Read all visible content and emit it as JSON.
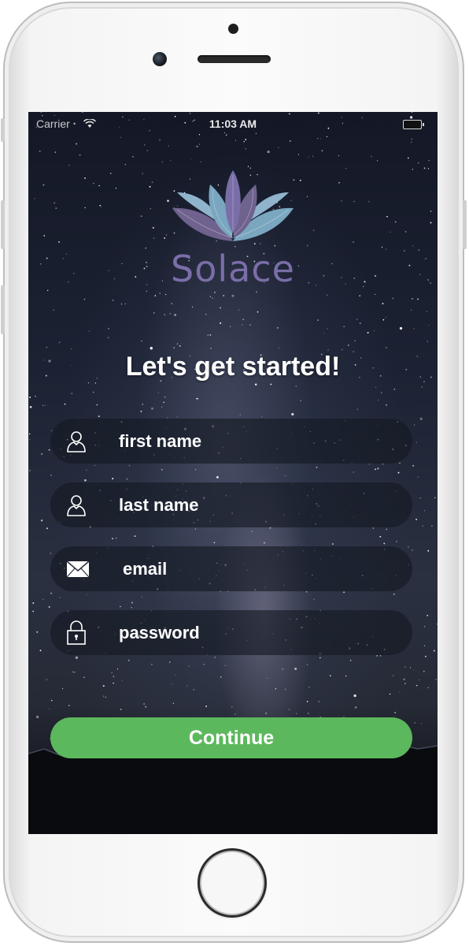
{
  "status_bar": {
    "carrier": "Carrier",
    "time": "11:03 AM"
  },
  "brand": {
    "name": "Solace",
    "logo_icon": "lotus-icon",
    "color": "#7a6ea8"
  },
  "heading": "Let's get started!",
  "form": {
    "first_name": {
      "placeholder": "first name",
      "value": "",
      "icon": "user-icon"
    },
    "last_name": {
      "placeholder": "last name",
      "value": "",
      "icon": "user-icon"
    },
    "email": {
      "placeholder": "email",
      "value": "",
      "icon": "envelope-icon"
    },
    "password": {
      "placeholder": "password",
      "value": "",
      "icon": "lock-icon"
    }
  },
  "continue_button": {
    "label": "Continue",
    "color": "#5cb85c"
  }
}
